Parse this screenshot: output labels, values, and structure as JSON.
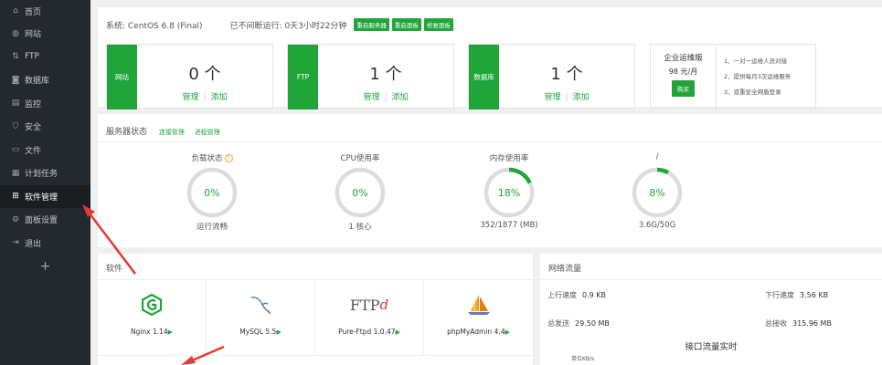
{
  "sidebar": {
    "items": [
      {
        "label": "首页",
        "icon": "home-icon",
        "glyph": "⌂"
      },
      {
        "label": "网站",
        "icon": "globe-icon",
        "glyph": "◍"
      },
      {
        "label": "FTP",
        "icon": "ftp-icon",
        "glyph": "⇅"
      },
      {
        "label": "数据库",
        "icon": "database-icon",
        "glyph": "◙"
      },
      {
        "label": "监控",
        "icon": "monitor-icon",
        "glyph": "▤"
      },
      {
        "label": "安全",
        "icon": "shield-icon",
        "glyph": "⛉"
      },
      {
        "label": "文件",
        "icon": "folder-icon",
        "glyph": "▭"
      },
      {
        "label": "计划任务",
        "icon": "calendar-icon",
        "glyph": "▦"
      },
      {
        "label": "软件管理",
        "icon": "apps-icon",
        "glyph": "⊞"
      },
      {
        "label": "面板设置",
        "icon": "gear-icon",
        "glyph": "⚙"
      },
      {
        "label": "退出",
        "icon": "logout-icon",
        "glyph": "⇥"
      }
    ],
    "add_label": "+"
  },
  "system": {
    "label": "系统: CentOS 6.8 (Final)",
    "uptime": "已不间断运行: 0天3小时22分钟",
    "buttons": [
      "重启服务器",
      "重启面板",
      "修复面板"
    ]
  },
  "stats": [
    {
      "tag": "网站",
      "count": "0 个",
      "manage": "管理",
      "add": "添加"
    },
    {
      "tag": "FTP",
      "count": "1 个",
      "manage": "管理",
      "add": "添加"
    },
    {
      "tag": "数据库",
      "count": "1 个",
      "manage": "管理",
      "add": "添加"
    }
  ],
  "vip": {
    "title": "企业运维版",
    "price": "98 元/月",
    "buy": "购买",
    "features": [
      "1、一对一运维人员对接",
      "2、提供每月3次运维服务",
      "3、双重安全网盾登录"
    ]
  },
  "server_status": {
    "title": "服务器状态",
    "links": [
      "连接管理",
      "进程管理"
    ],
    "gauges": [
      {
        "label": "负载状态",
        "value": "0%",
        "percent": 0,
        "bottom": "运行流畅",
        "help": "?"
      },
      {
        "label": "CPU使用率",
        "value": "0%",
        "percent": 0,
        "bottom": "1 核心",
        "help": ""
      },
      {
        "label": "内存使用率",
        "value": "18%",
        "percent": 18,
        "bottom": "352/1877 (MB)",
        "help": ""
      },
      {
        "label": "/",
        "value": "8%",
        "percent": 8,
        "bottom": "3.6G/50G",
        "help": ""
      }
    ]
  },
  "software": {
    "title": "软件",
    "items": [
      {
        "name": "Nginx 1.14",
        "icon": "nginx-icon"
      },
      {
        "name": "MySQL 5.5",
        "icon": "mysql-icon"
      },
      {
        "name": "Pure-Ftpd 1.0.47",
        "icon": "ftpd-icon"
      },
      {
        "name": "phpMyAdmin 4.4",
        "icon": "phpmyadmin-icon"
      }
    ],
    "ftp_logo": "FTP",
    "ftp_logo_d": "d",
    "play": "▶"
  },
  "network": {
    "title": "网络流量",
    "up_speed_label": "上行速度",
    "up_speed": "0.9 KB",
    "down_speed_label": "下行速度",
    "down_speed": "3.56 KB",
    "total_sent_label": "总发送",
    "total_sent": "29.50 MB",
    "total_recv_label": "总接收",
    "total_recv": "315.96 MB",
    "realtime": "接口流量实时",
    "unit": "单位KB/s"
  },
  "colors": {
    "accent": "#20a53a",
    "sidebar": "#23292e",
    "arrow": "#e53935"
  }
}
